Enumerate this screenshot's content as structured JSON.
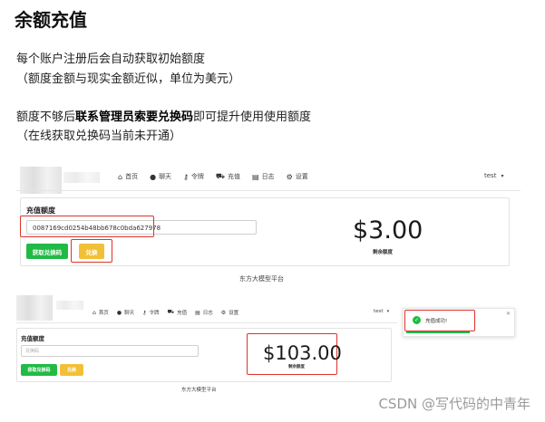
{
  "title": "余额充值",
  "para1": {
    "line1": "每个账户注册后会自动获取初始额度",
    "line2": "（额度金额与现实金额近似，单位为美元）"
  },
  "para2": {
    "prefix": "额度不够后",
    "bold": "联系管理员索要兑换码",
    "suffix": "即可提升使用使用额度",
    "line2": "（在线获取兑换码当前未开通）"
  },
  "shot1": {
    "nav": {
      "home": "首页",
      "chat": "聊天",
      "token": "令牌",
      "topup": "充值",
      "log": "日志",
      "settings": "设置",
      "user": "test"
    },
    "card_title": "充值额度",
    "code_value": "0087169cd0254b48bb678c0bda627978",
    "get_code_label": "获取兑换码",
    "redeem_label": "兑换",
    "amount": "$3.00",
    "amount_label": "剩余额度",
    "footer": "东方大模型平台"
  },
  "shot2": {
    "nav": {
      "home": "首页",
      "chat": "聊天",
      "token": "令牌",
      "topup": "充值",
      "log": "日志",
      "settings": "设置",
      "user": "test"
    },
    "card_title": "充值额度",
    "code_placeholder": "兑换码",
    "get_code_label": "获取兑换码",
    "redeem_label": "兑换",
    "amount": "$103.00",
    "amount_label": "剩余额度",
    "footer": "东方大模型平台",
    "toast_text": "充值成功!"
  },
  "watermark": "CSDN @写代码的中青年",
  "icons": {
    "home": "home-icon",
    "chat": "chat-icon",
    "token": "key-icon",
    "topup": "cart-icon",
    "log": "book-icon",
    "settings": "gear-icon",
    "close": "close-icon",
    "check": "check-icon"
  }
}
